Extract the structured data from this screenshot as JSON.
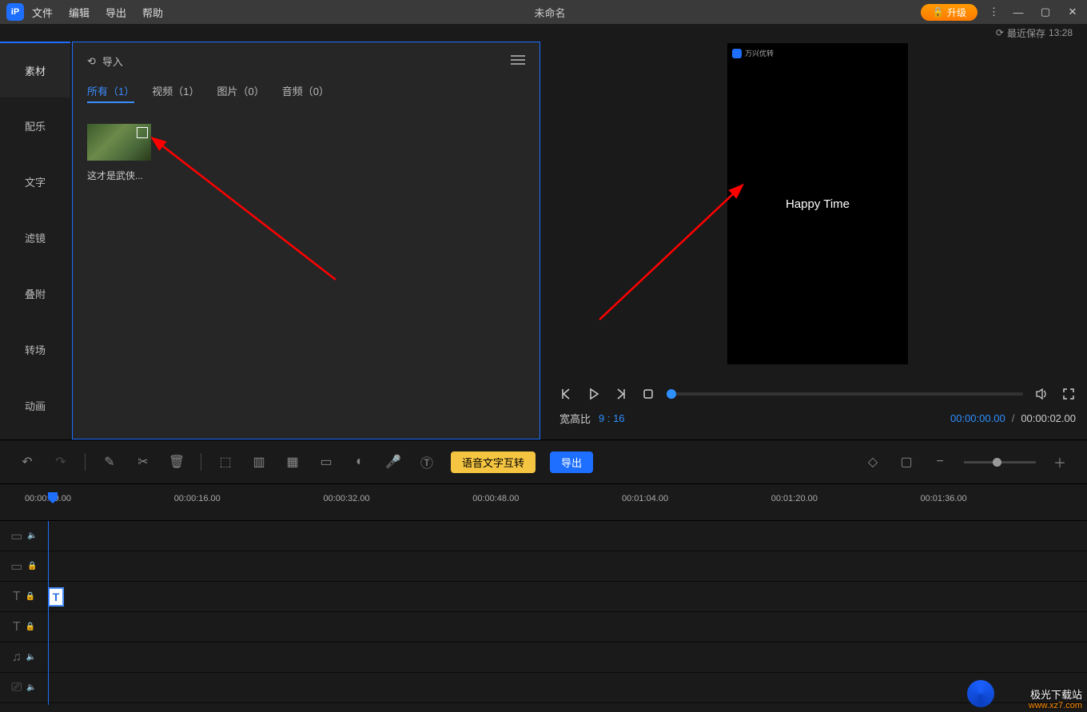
{
  "titlebar": {
    "menu": {
      "file": "文件",
      "edit": "编辑",
      "export": "导出",
      "help": "帮助"
    },
    "title": "未命名",
    "upgrade": "升级"
  },
  "save_status": {
    "label": "最近保存",
    "time": "13:28"
  },
  "sidebar": {
    "items": [
      {
        "label": "素材"
      },
      {
        "label": "配乐"
      },
      {
        "label": "文字"
      },
      {
        "label": "滤镜"
      },
      {
        "label": "叠附"
      },
      {
        "label": "转场"
      },
      {
        "label": "动画"
      }
    ]
  },
  "assets": {
    "import": "导入",
    "tabs": {
      "all": "所有（1）",
      "video": "视频（1）",
      "image": "图片（0）",
      "audio": "音频（0）"
    },
    "thumb_caption": "这才是武侠..."
  },
  "preview": {
    "logo_text": "万兴优转",
    "overlay_text": "Happy Time",
    "ratio_label": "宽高比",
    "ratio_value": "9 : 16",
    "time_current": "00:00:00.00",
    "time_total": "00:00:02.00"
  },
  "toolbar": {
    "voice_btn": "语音文字互转",
    "export_btn": "导出"
  },
  "ruler": {
    "labels": [
      "00:00:00.00",
      "00:00:16.00",
      "00:00:32.00",
      "00:00:48.00",
      "00:01:04.00",
      "00:01:20.00",
      "00:01:36.00"
    ]
  },
  "clip": {
    "text": "T"
  },
  "watermark": {
    "line1": "极光下载站",
    "line2": "www.xz7.com"
  }
}
